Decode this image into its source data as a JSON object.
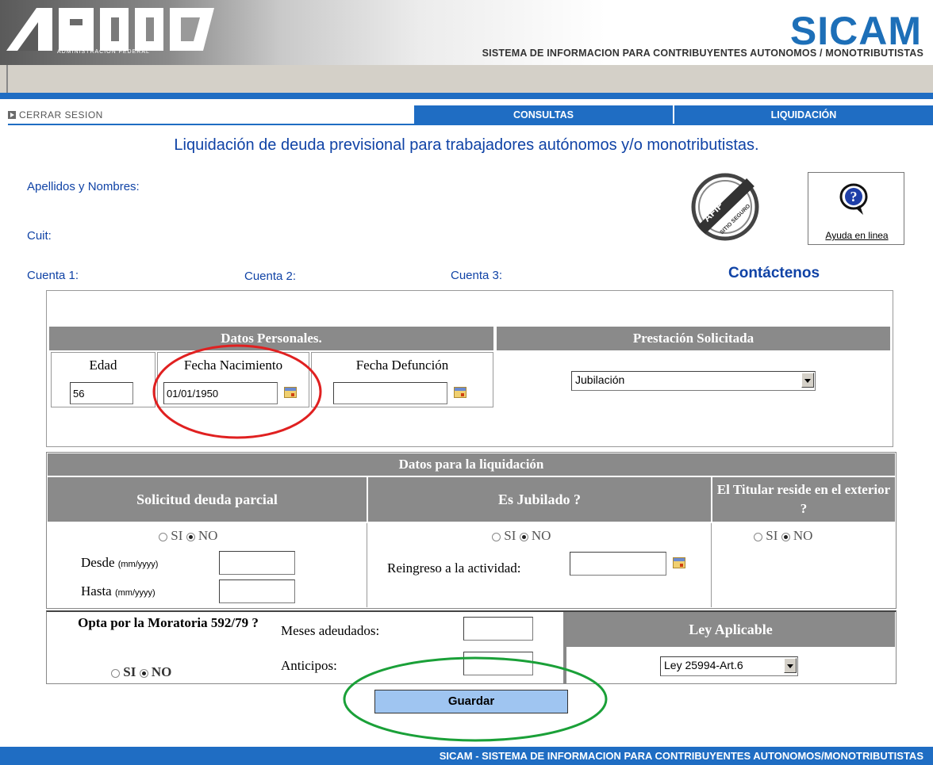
{
  "header": {
    "logo_text": "AFIP",
    "logo_subtext": "ADMINISTRACION FEDERAL",
    "brand": "SICAM",
    "subtitle": "SISTEMA DE INFORMACION PARA CONTRIBUYENTES AUTONOMOS / MONOTRIBUTISTAS"
  },
  "nav": {
    "logout": "CERRAR SESION",
    "tabs": [
      {
        "label": "CONSULTAS"
      },
      {
        "label": "LIQUIDACIÓN"
      }
    ]
  },
  "page_title": "Liquidación de deuda previsional para trabajadores autónomos y/o monotributistas.",
  "info": {
    "name_label": "Apellidos y Nombres:",
    "cuit_label": "Cuit:",
    "cuenta1": "Cuenta 1:",
    "cuenta2": "Cuenta 2:",
    "cuenta3": "Cuenta 3:",
    "contact": "Contáctenos",
    "help_label": "Ayuda en linea",
    "seal_text": "SITIO SEGURO"
  },
  "personal": {
    "header": "Datos Personales.",
    "edad_label": "Edad",
    "edad_value": "56",
    "nacimiento_label": "Fecha Nacimiento",
    "nacimiento_value": "01/01/1950",
    "defuncion_label": "Fecha Defunción",
    "defuncion_value": ""
  },
  "prestacion": {
    "header": "Prestación Solicitada",
    "selected": "Jubilación"
  },
  "liquidacion": {
    "header": "Datos para la liquidación",
    "col1": "Solicitud deuda parcial",
    "col2": "Es Jubilado ?",
    "col3": "El Titular reside en el exterior ?",
    "si": "SI",
    "no": "NO",
    "desde": "Desde",
    "hasta": "Hasta",
    "fmt": "(mm/yyyy)",
    "reingreso": "Reingreso a la actividad:"
  },
  "moratoria": {
    "question": "Opta por la Moratoria 592/79 ?",
    "si": "SI",
    "no": "NO",
    "meses": "Meses adeudados:",
    "anticipos": "Anticipos:",
    "ley_header": "Ley Aplicable",
    "ley_selected": "Ley 25994-Art.6"
  },
  "save_button": "Guardar",
  "footer": "SICAM - SISTEMA DE INFORMACION PARA CONTRIBUYENTES AUTONOMOS/MONOTRIBUTISTAS",
  "colors": {
    "accent": "#1f6dc3",
    "title": "#1043a6",
    "section_header": "#8a8a8a",
    "button": "#9fc5f1",
    "highlight_red": "#e02020",
    "highlight_green": "#1aa038"
  }
}
